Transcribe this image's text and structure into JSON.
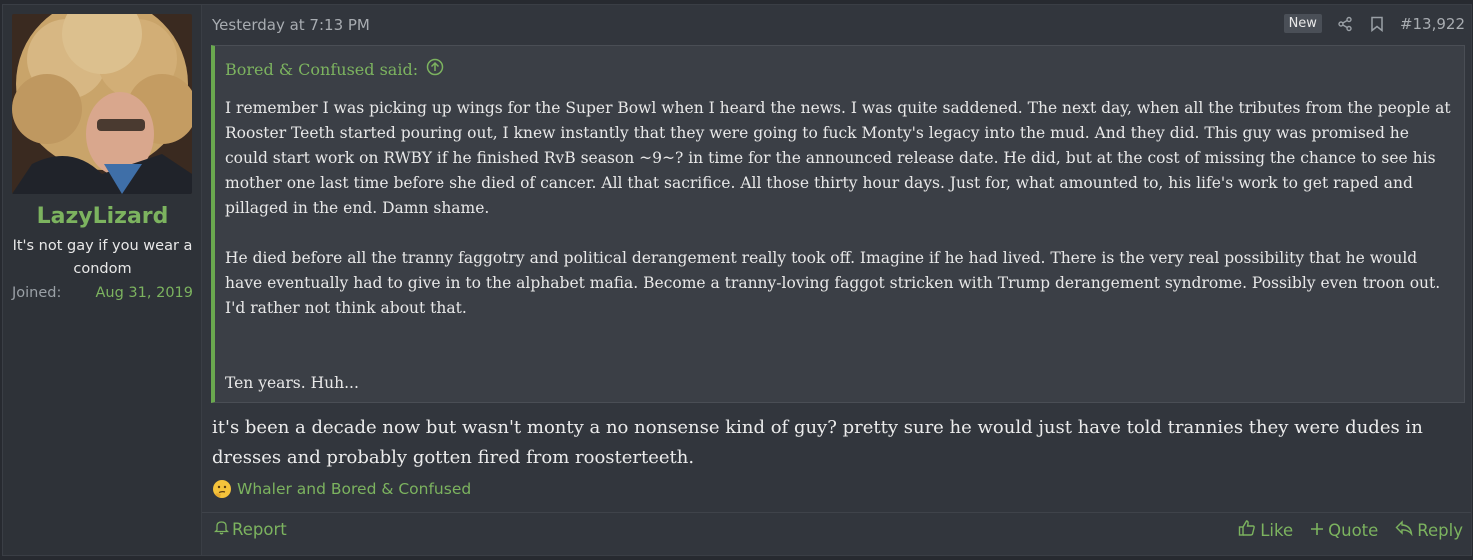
{
  "user": {
    "username": "LazyLizard",
    "title": "It's not gay if you wear a condom",
    "joined_label": "Joined:",
    "joined_date": "Aug 31, 2019",
    "avatar_icon": "user-avatar"
  },
  "post": {
    "timestamp": "Yesterday at 7:13 PM",
    "new_badge": "New",
    "share_icon": "share-icon",
    "bookmark_icon": "bookmark-icon",
    "number": "#13,922",
    "quote": {
      "author_said": "Bored & Confused said:",
      "paragraph1": "I remember I was picking up wings for the Super Bowl when I heard the news. I was quite saddened. The next day, when all the tributes from the people at Rooster Teeth started pouring out, I knew instantly that they were going to fuck Monty's legacy into the mud. And they did. This guy was promised he could start work on RWBY if he finished RvB season ~9~? in time for the announced release date. He did, but at the cost of missing the chance to see his mother one last time before she died of cancer. All that sacrifice. All those thirty hour days. Just for, what amounted to, his life's work to get raped and pillaged in the end. Damn shame.",
      "paragraph2": "He died before all the tranny faggotry and political derangement really took off. Imagine if he had lived. There is the very real possibility that he would have eventually had to give in to the alphabet mafia. Become a tranny-loving faggot stricken with Trump derangement syndrome. Possibly even troon out. I'd rather not think about that.",
      "paragraph3": "Ten years. Huh..."
    },
    "message": "it's been a decade now but wasn't monty a no nonsense kind of guy? pretty sure he would just have told trannies they were dudes in dresses and probably gotten fired from roosterteeth.",
    "reactions": "Whaler and Bored & Confused",
    "reaction_icon": "thinking-face-emoji"
  },
  "actions": {
    "report": "Report",
    "like": "Like",
    "quote": "Quote",
    "reply": "Reply"
  },
  "colors": {
    "accent": "#7cb35f",
    "background": "#32363d",
    "quote_bg": "#3b3f46"
  }
}
